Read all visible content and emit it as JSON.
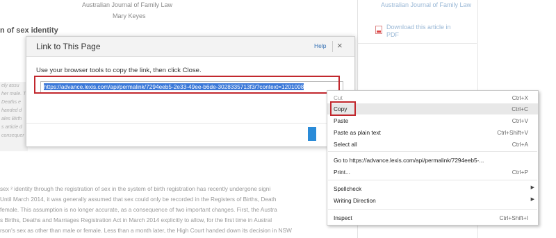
{
  "article": {
    "journal": "Australian Journal of Family Law",
    "author": "Mary Keyes",
    "section_title": "n of sex identity",
    "excerpt_lines": [
      "ely assu",
      "her male. Th",
      "Deaths e",
      "handed d",
      "ales Birth",
      "s article d",
      "consequer"
    ],
    "body_lines": [
      "sex ² identity through the registration of sex in the system of birth registration has recently undergone signi",
      "Until March 2014, it was generally assumed that sex could only be recorded in the Registers of Births, Death",
      "female. This assumption is no longer accurate, as a consequence of two important changes. First, the Austra",
      "s Births, Deaths and Marriages Registration Act in March 2014 explicitly to allow, for the first time in Austral",
      "rson's sex as other than male or female. Less than a month later, the High Court handed down its decision in NSW"
    ]
  },
  "sidebar": {
    "journal_link": "Australian Journal of Family Law",
    "download_link": "Download this article in PDF"
  },
  "modal": {
    "title": "Link to This Page",
    "help_label": "Help",
    "close_label": "×",
    "instruction": "Use your browser tools to copy the link, then click Close.",
    "link_value": "https://advance.lexis.com/api/permalink/7294eeb5-2e33-49ee-b6de-3028335713f3/?context=1201008"
  },
  "context_menu": {
    "items": [
      {
        "label": "Cut",
        "shortcut": "Ctrl+X"
      },
      {
        "label": "Copy",
        "shortcut": "Ctrl+C"
      },
      {
        "label": "Paste",
        "shortcut": "Ctrl+V"
      },
      {
        "label": "Paste as plain text",
        "shortcut": "Ctrl+Shift+V"
      },
      {
        "label": "Select all",
        "shortcut": "Ctrl+A"
      },
      {
        "label": "Go to https://advance.lexis.com/api/permalink/7294eeb5-...",
        "shortcut": ""
      },
      {
        "label": "Print...",
        "shortcut": "Ctrl+P"
      },
      {
        "label": "Spellcheck",
        "shortcut": ""
      },
      {
        "label": "Writing Direction",
        "shortcut": ""
      },
      {
        "label": "Inspect",
        "shortcut": "Ctrl+Shift+I"
      }
    ]
  },
  "colors": {
    "highlight_border": "#c1272d",
    "selection": "#3b78d8",
    "link": "#3a74b6"
  }
}
